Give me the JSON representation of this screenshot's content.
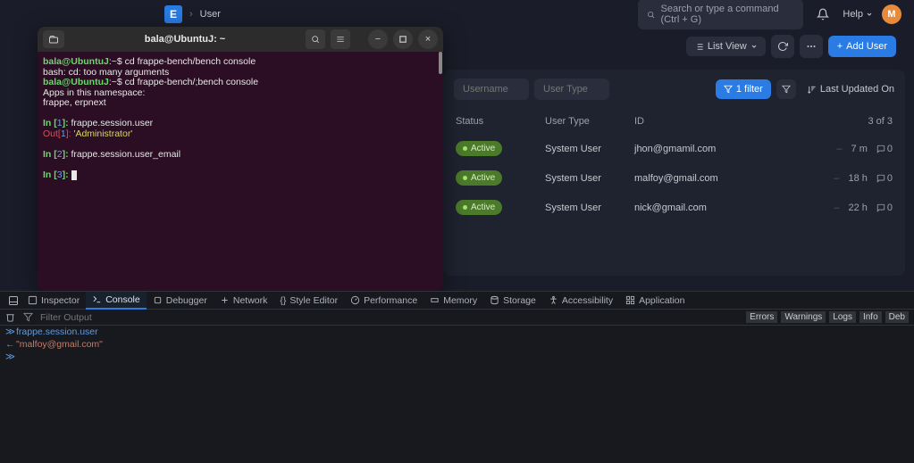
{
  "nav": {
    "logo_letter": "E",
    "breadcrumb": "User",
    "search_placeholder": "Search or type a command (Ctrl + G)",
    "help": "Help",
    "avatar_letter": "M"
  },
  "toolbar": {
    "list_view": "List View",
    "add_user": "Add User"
  },
  "filters": {
    "username_ph": "Username",
    "usertype_ph": "User Type",
    "filter_label": "1 filter",
    "sort_label": "Last Updated On"
  },
  "list": {
    "headers": {
      "status": "Status",
      "type": "User Type",
      "id": "ID",
      "count": "3 of 3"
    },
    "rows": [
      {
        "status": "Active",
        "type": "System User",
        "id": "jhon@gmamil.com",
        "age": "7 m",
        "comments": "0",
        "dash": "–"
      },
      {
        "status": "Active",
        "type": "System User",
        "id": "malfoy@gmail.com",
        "age": "18 h",
        "comments": "0",
        "dash": "–"
      },
      {
        "status": "Active",
        "type": "System User",
        "id": "nick@gmail.com",
        "age": "22 h",
        "comments": "0",
        "dash": "–"
      }
    ]
  },
  "terminal": {
    "title": "bala@UbuntuJ: ~",
    "lines": {
      "l1_user": "bala@UbuntuJ",
      "l1_path": ":~$ ",
      "l1_cmd": "cd frappe-bench/bench console",
      "l2": "bash: cd: too many arguments",
      "l3_user": "bala@UbuntuJ",
      "l3_path": ":~$ ",
      "l3_cmd": "cd frappe-bench/;bench console",
      "l4": "Apps in this namespace:",
      "l5": "frappe, erpnext",
      "in1_pre": "In [",
      "in1_n": "1",
      "in1_post": "]: ",
      "in1_cmd": "frappe.session.user",
      "out1_pre": "Out[",
      "out1_n": "1",
      "out1_post": "]: ",
      "out1_val": "'Administrator'",
      "in2_n": "2",
      "in2_cmd": "frappe.session.user_email",
      "in3_n": "3"
    }
  },
  "devtools": {
    "tabs": {
      "inspector": "Inspector",
      "console": "Console",
      "debugger": "Debugger",
      "network": "Network",
      "style": "Style Editor",
      "perf": "Performance",
      "memory": "Memory",
      "storage": "Storage",
      "a11y": "Accessibility",
      "app": "Application"
    },
    "filter_ph": "Filter Output",
    "levels": {
      "errors": "Errors",
      "warnings": "Warnings",
      "logs": "Logs",
      "info": "Info",
      "debug": "Deb"
    },
    "input_expr": "frappe.session.user",
    "output_str": "\"malfoy@gmail.com\""
  }
}
